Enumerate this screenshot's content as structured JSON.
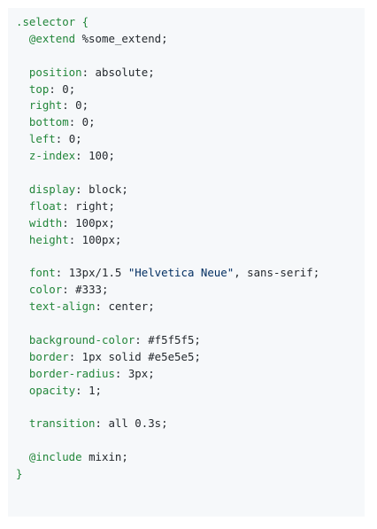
{
  "code": {
    "lines": [
      {
        "kind": "selector",
        "selector": ".selector",
        "brace": " {"
      },
      {
        "kind": "directive",
        "indent": "  ",
        "keyword": "@extend",
        "value": " %some_extend;"
      },
      {
        "kind": "blank"
      },
      {
        "kind": "decl",
        "indent": "  ",
        "prop": "position",
        "colon": ": ",
        "value": "absolute",
        "semi": ";"
      },
      {
        "kind": "decl",
        "indent": "  ",
        "prop": "top",
        "colon": ": ",
        "value": "0",
        "semi": ";"
      },
      {
        "kind": "decl",
        "indent": "  ",
        "prop": "right",
        "colon": ": ",
        "value": "0",
        "semi": ";"
      },
      {
        "kind": "decl",
        "indent": "  ",
        "prop": "bottom",
        "colon": ": ",
        "value": "0",
        "semi": ";"
      },
      {
        "kind": "decl",
        "indent": "  ",
        "prop": "left",
        "colon": ": ",
        "value": "0",
        "semi": ";"
      },
      {
        "kind": "decl",
        "indent": "  ",
        "prop": "z-index",
        "colon": ": ",
        "value": "100",
        "semi": ";"
      },
      {
        "kind": "blank"
      },
      {
        "kind": "decl",
        "indent": "  ",
        "prop": "display",
        "colon": ": ",
        "value": "block",
        "semi": ";"
      },
      {
        "kind": "decl",
        "indent": "  ",
        "prop": "float",
        "colon": ": ",
        "value": "right",
        "semi": ";"
      },
      {
        "kind": "decl",
        "indent": "  ",
        "prop": "width",
        "colon": ": ",
        "value": "100px",
        "semi": ";"
      },
      {
        "kind": "decl",
        "indent": "  ",
        "prop": "height",
        "colon": ": ",
        "value": "100px",
        "semi": ";"
      },
      {
        "kind": "blank"
      },
      {
        "kind": "font",
        "indent": "  ",
        "prop": "font",
        "colon": ": ",
        "value_a": "13px/1.5 ",
        "str": "\"Helvetica Neue\"",
        "value_b": ", sans-serif",
        "semi": ";"
      },
      {
        "kind": "decl",
        "indent": "  ",
        "prop": "color",
        "colon": ": ",
        "value": "#333",
        "semi": ";"
      },
      {
        "kind": "decl",
        "indent": "  ",
        "prop": "text-align",
        "colon": ": ",
        "value": "center",
        "semi": ";"
      },
      {
        "kind": "blank"
      },
      {
        "kind": "decl",
        "indent": "  ",
        "prop": "background-color",
        "colon": ": ",
        "value": "#f5f5f5",
        "semi": ";"
      },
      {
        "kind": "decl",
        "indent": "  ",
        "prop": "border",
        "colon": ": ",
        "value": "1px solid #e5e5e5",
        "semi": ";"
      },
      {
        "kind": "decl",
        "indent": "  ",
        "prop": "border-radius",
        "colon": ": ",
        "value": "3px",
        "semi": ";"
      },
      {
        "kind": "decl",
        "indent": "  ",
        "prop": "opacity",
        "colon": ": ",
        "value": "1",
        "semi": ";"
      },
      {
        "kind": "blank"
      },
      {
        "kind": "decl",
        "indent": "  ",
        "prop": "transition",
        "colon": ": ",
        "value": "all 0.3s",
        "semi": ";"
      },
      {
        "kind": "blank"
      },
      {
        "kind": "directive",
        "indent": "  ",
        "keyword": "@include",
        "value": " mixin;"
      },
      {
        "kind": "close",
        "brace": "}"
      }
    ]
  },
  "colors": {
    "background": "#f6f8fa",
    "syntax_green": "#22863a",
    "string_blue": "#032f62",
    "text": "#24292e"
  }
}
